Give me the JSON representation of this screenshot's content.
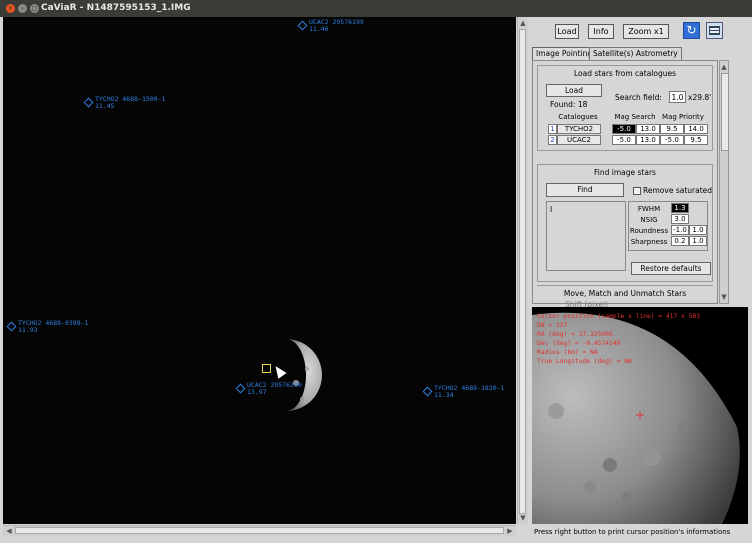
{
  "window": {
    "title": "CaViaR - N1487595153_1.IMG"
  },
  "viewer": {
    "stars": [
      {
        "id": "UCAC2 29576199",
        "mag": "11.46"
      },
      {
        "id": "TYCHO2 4688-1500-1",
        "mag": "11.45"
      },
      {
        "id": "TYCHO2 4688-0398-1",
        "mag": "11.93"
      },
      {
        "id": "UCAC2 29576200",
        "mag": "13.97"
      },
      {
        "id": "TYCHO2 4688-1820-1",
        "mag": "11.34"
      }
    ]
  },
  "toolbar": {
    "load": "Load",
    "info": "Info",
    "zoom": "Zoom x1",
    "refresh_icon": "refresh-icon",
    "table_icon": "table-icon"
  },
  "tabs": [
    "Image Pointing",
    "Satellite(s) Astrometry"
  ],
  "load_section": {
    "title": "Load stars from catalogues",
    "load_button": "Load",
    "search_field_label": "Search field:",
    "search_field_value": "1.0",
    "search_field_unit": "x29.8'",
    "found": "Found: 18",
    "headers": [
      "Catalogues",
      "Mag Search",
      "Mag Priority"
    ],
    "rows": [
      {
        "index": "1",
        "catalogue": "TYCHO2",
        "search_min": "-5.0",
        "search_max": "13.0",
        "priority_min": "9.5",
        "priority_max": "14.0"
      },
      {
        "index": "2",
        "catalogue": "UCAC2",
        "search_min": "-5.0",
        "search_max": "13.0",
        "priority_min": "-5.0",
        "priority_max": "9.5"
      }
    ]
  },
  "find_section": {
    "title": "Find image stars",
    "find_button": "Find",
    "remove_saturated": "Remove saturated",
    "cursor": "I",
    "params": [
      {
        "label": "FWHM",
        "v1": "1.3",
        "v2": ""
      },
      {
        "label": "NSIG",
        "v1": "3.0",
        "v2": ""
      },
      {
        "label": "Roundness",
        "v1": "-1.0",
        "v2": "1.0"
      },
      {
        "label": "Sharpness",
        "v1": "0.2",
        "v2": "1.0"
      }
    ],
    "restore": "Restore defaults"
  },
  "move_section": {
    "title": "Move, Match and Unmatch Stars",
    "partial": "Shift (pixel)"
  },
  "zoom_info": {
    "cursor_position": "Cursor position (sample x line) = 417 x 583",
    "dn": "DN           = 117",
    "ra": "RA  (deg) = 27.325005",
    "dec": "Dec (deg) = -0.4574149",
    "radius": "Radius (km)              = NA",
    "longitude": "True Longitude (deg) = NA"
  },
  "status": "Press right button to print cursor position's informations",
  "colors": {
    "star_marker": "#2f7fe0",
    "info_text": "#e23333",
    "selected_cell": "#000000"
  }
}
